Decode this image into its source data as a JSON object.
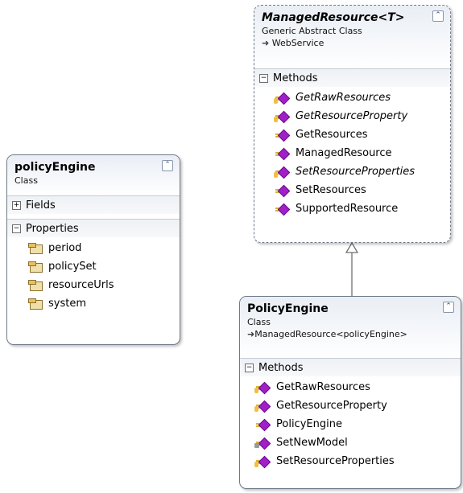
{
  "classes": {
    "policy_engine_small": {
      "name": "policyEngine",
      "stereotype": "Class",
      "collapse_glyph": "⌃",
      "sections": {
        "fields": {
          "label": "Fields",
          "toggle": "+"
        },
        "properties": {
          "label": "Properties",
          "toggle": "−",
          "items": [
            "period",
            "policySet",
            "resourceUrls",
            "system"
          ]
        }
      }
    },
    "managed_resource": {
      "name": "ManagedResource<T>",
      "stereotype": "Generic Abstract Class",
      "base": "WebService",
      "base_arrow": "➜",
      "collapse_glyph": "⌃",
      "sections": {
        "methods": {
          "label": "Methods",
          "toggle": "−",
          "items": [
            {
              "name": "GetRawResources",
              "icon": "method-icon",
              "italic": true,
              "key": true
            },
            {
              "name": "GetResourceProperty",
              "icon": "method-icon",
              "italic": true,
              "key": true
            },
            {
              "name": "GetResources",
              "icon": "method-icon",
              "italic": false,
              "key": false
            },
            {
              "name": "ManagedResource",
              "icon": "method-icon",
              "italic": false,
              "key": false
            },
            {
              "name": "SetResourceProperties",
              "icon": "method-icon",
              "italic": true,
              "key": true
            },
            {
              "name": "SetResources",
              "icon": "method-icon",
              "italic": false,
              "key": false
            },
            {
              "name": "SupportedResource",
              "icon": "method-icon",
              "italic": false,
              "key": false
            }
          ]
        }
      }
    },
    "policy_engine_big": {
      "name": "PolicyEngine",
      "stereotype": "Class",
      "base": "ManagedResource<policyEngine>",
      "base_arrow": "➜",
      "collapse_glyph": "⌃",
      "sections": {
        "methods": {
          "label": "Methods",
          "toggle": "−",
          "items": [
            {
              "name": "GetRawResources",
              "icon": "method-icon",
              "key": true,
              "lock": false
            },
            {
              "name": "GetResourceProperty",
              "icon": "method-icon",
              "key": true,
              "lock": false
            },
            {
              "name": "PolicyEngine",
              "icon": "method-icon",
              "key": false,
              "lock": false
            },
            {
              "name": "SetNewModel",
              "icon": "method-icon",
              "key": false,
              "lock": true
            },
            {
              "name": "SetResourceProperties",
              "icon": "method-icon",
              "key": true,
              "lock": false
            }
          ]
        }
      }
    }
  },
  "colors": {
    "border": "#6e7a8a",
    "method": "#a020c8",
    "header": "#e9eef5"
  }
}
